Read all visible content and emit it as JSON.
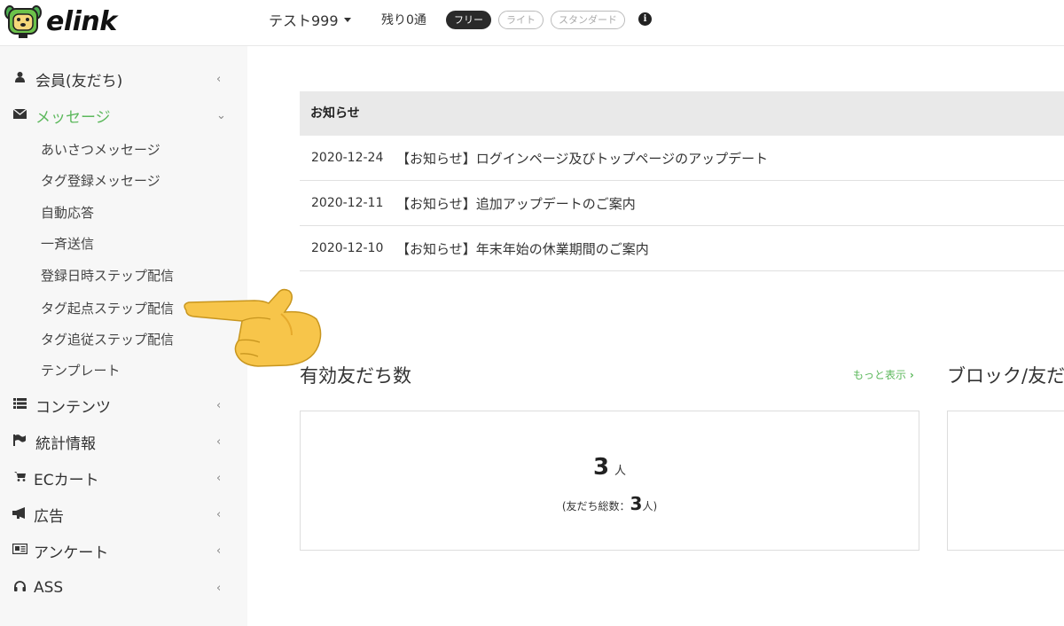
{
  "header": {
    "logo_text": "elink",
    "account_name": "テスト999",
    "remaining": "残り0通",
    "plans": [
      "フリー",
      "ライト",
      "スタンダード"
    ],
    "active_plan": "フリー"
  },
  "sidebar": {
    "items": [
      {
        "label": "会員(友だち)",
        "icon": "user-icon",
        "glyph": "👤"
      },
      {
        "label": "メッセージ",
        "icon": "envelope-icon",
        "glyph": "✉",
        "active": true
      },
      {
        "label": "コンテンツ",
        "icon": "list-icon",
        "glyph": "☰"
      },
      {
        "label": "統計情報",
        "icon": "flag-icon",
        "glyph": "⚑"
      },
      {
        "label": "ECカート",
        "icon": "cart-icon",
        "glyph": "🛒"
      },
      {
        "label": "広告",
        "icon": "megaphone-icon",
        "glyph": "📢"
      },
      {
        "label": "アンケート",
        "icon": "newspaper-icon",
        "glyph": "▤"
      },
      {
        "label": "ASS",
        "icon": "headset-icon",
        "glyph": "☊"
      }
    ],
    "message_subitems": [
      "あいさつメッセージ",
      "タグ登録メッセージ",
      "自動応答",
      "一斉送信",
      "登録日時ステップ配信",
      "タグ起点ステップ配信",
      "タグ追従ステップ配信",
      "テンプレート"
    ]
  },
  "notices": {
    "header": "お知らせ",
    "rows": [
      {
        "date": "2020-12-24",
        "title": "【お知らせ】ログインページ及びトップページのアップデート"
      },
      {
        "date": "2020-12-11",
        "title": "【お知らせ】追加アップデートのご案内"
      },
      {
        "date": "2020-12-10",
        "title": "【お知らせ】年末年始の休業期間のご案内"
      }
    ]
  },
  "friends": {
    "title": "有効友だち数",
    "more_link": "もっと表示",
    "count": "3",
    "unit": "人",
    "total_prefix": "(友だち総数：",
    "total": "3",
    "total_suffix": "人)"
  },
  "blocks": {
    "title": "ブロック/友だ"
  },
  "colors": {
    "accent": "#5cb85c",
    "sidebar_bg": "#f7f7f7",
    "table_header_bg": "#e9e9e9"
  }
}
